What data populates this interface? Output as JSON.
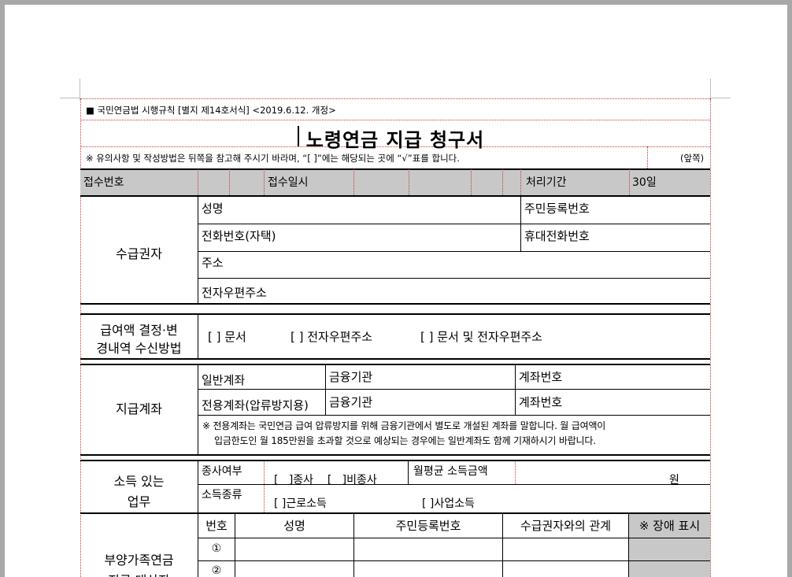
{
  "header": {
    "regulation": "■ 국민연금법 시행규칙 [별지 제14호서식] <2019.6.12. 개정>"
  },
  "form": {
    "title": "노령연금 지급 청구서",
    "notice": "※ 유의사항 및 작성방법은 뒤쪽을 참고해 주시기 바라며, “[ ]”에는 해당되는 곳에 “√”표를 합니다.",
    "side": "(앞쪽)"
  },
  "receipt": {
    "number": "접수번호",
    "date": "접수일시",
    "period_label": "처리기간",
    "period_value": "30일"
  },
  "recipient": {
    "label": "수급권자",
    "name": "성명",
    "rrn": "주민등록번호",
    "phone_home": "전화번호(자택)",
    "phone_mobile": "휴대전화번호",
    "address": "주소",
    "email": "전자우편주소"
  },
  "notification": {
    "label_line1": "급여액 결정·변",
    "label_line2": "경내역 수신방법",
    "opt1": "[   ] 문서",
    "opt2": "[   ] 전자우편주소",
    "opt3": "[   ] 문서 및 전자우편주소"
  },
  "account": {
    "label": "지급계좌",
    "general": "일반계좌",
    "dedicated": "전용계좌(압류방지용)",
    "bank1": "금융기관",
    "acct1": "계좌번호",
    "bank2": "금융기관",
    "acct2": "계좌번호",
    "note_line1": "※ 전용계좌는 국민연금 급여 압류방지를 위해 금융기관에서 별도로 개설된 계좌를 말합니다. 월 급여액이",
    "note_line2": "입금한도인 월 185만원을 초과할 것으로 예상되는 경우에는 일반계좌도 함께 기재하시기 바랍니다."
  },
  "income": {
    "label_line1": "소득 있는",
    "label_line2": "업무",
    "employed": "종사여부",
    "employed_opt": "[   ]종사    [   ]비종사",
    "monthly": "월평균 소득금액",
    "won": "원",
    "type": "소득종류",
    "type_opt1": "[   ]근로소득",
    "type_opt2": "[   ]사업소득"
  },
  "dependents": {
    "label_line1": "부양가족연금",
    "label_line2": "지급 대상자",
    "headers": [
      "번호",
      "성명",
      "주민등록번호",
      "수급권자와의 관계",
      "※ 장애 표시"
    ],
    "rows": [
      "①",
      "②"
    ]
  }
}
